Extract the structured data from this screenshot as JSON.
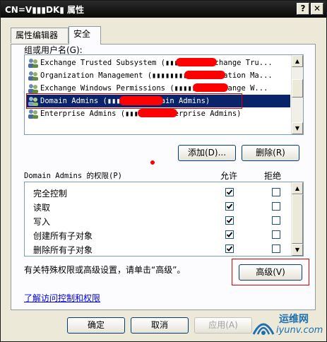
{
  "window": {
    "title": "CN=V▮▮▮DK▮ 属性",
    "help_button": "?",
    "close_button": "✕"
  },
  "tabs": [
    {
      "label": "属性编辑器",
      "active": false
    },
    {
      "label": "安全",
      "active": true
    }
  ],
  "groups": {
    "label": "组或用户名(G):",
    "items": [
      {
        "name": "Exchange Trusted Subsystem (▮▮▮▮▮▮▮▮\\Exchange Tru...",
        "selected": false
      },
      {
        "name": "Organization Management (▮▮▮▮▮▮▮▮\\Organization Ma...",
        "selected": false
      },
      {
        "name": "Exchange Windows Permissions (▮▮▮▮▮▮▮\\Exchange W...",
        "selected": false
      },
      {
        "name": "Domain Admins (▮▮▮▮▮▮▮▮\\Domain Admins)",
        "selected": true
      },
      {
        "name": "Enterprise Admins (▮▮▮▮▮▮▮\\Enterprise Admins)",
        "selected": false
      }
    ]
  },
  "buttons": {
    "add": "添加(D)...",
    "remove": "删除(R)",
    "advanced": "高级(V)",
    "ok": "确定",
    "cancel": "取消",
    "apply": "应用(A)"
  },
  "permissions": {
    "title": "Domain Admins 的权限(P)",
    "allow_header": "允许",
    "deny_header": "拒绝",
    "rows": [
      {
        "name": "完全控制",
        "allow": true,
        "deny": false
      },
      {
        "name": "读取",
        "allow": true,
        "deny": false
      },
      {
        "name": "写入",
        "allow": true,
        "deny": false
      },
      {
        "name": "创建所有子对象",
        "allow": true,
        "deny": false
      },
      {
        "name": "删除所有子对象",
        "allow": true,
        "deny": false
      }
    ]
  },
  "advanced_hint": "有关特殊权限或高级设置，请单击“高级”。",
  "link": "了解访问控制和权限",
  "watermark": {
    "line1": "运维网",
    "line2": "iyunv.com"
  },
  "colors": {
    "title_bar": "#0a0a0a",
    "selection": "#0a246a",
    "annotation_red": "#e00000",
    "link": "#0000ee"
  }
}
